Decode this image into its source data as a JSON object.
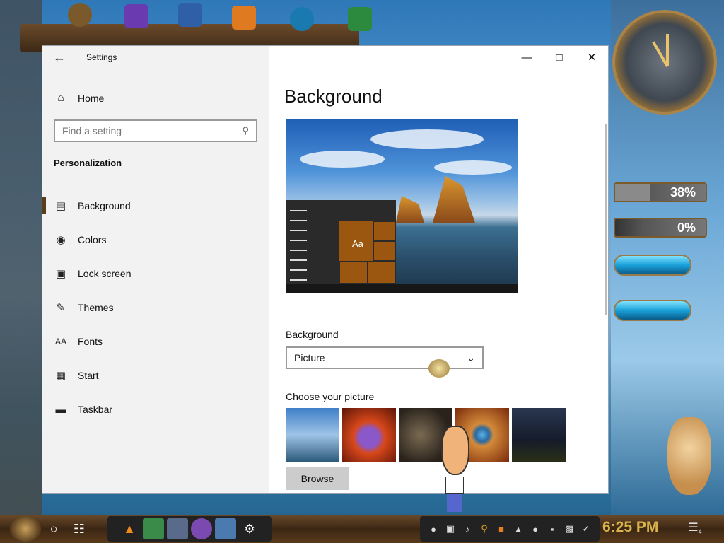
{
  "window": {
    "app_title": "Settings",
    "back_icon": "arrow-left-icon"
  },
  "sidebar": {
    "home_label": "Home",
    "search_placeholder": "Find a setting",
    "section_title": "Personalization",
    "items": [
      {
        "label": "Background",
        "icon": "picture-icon",
        "active": true
      },
      {
        "label": "Colors",
        "icon": "palette-icon",
        "active": false
      },
      {
        "label": "Lock screen",
        "icon": "lock-screen-icon",
        "active": false
      },
      {
        "label": "Themes",
        "icon": "brush-icon",
        "active": false
      },
      {
        "label": "Fonts",
        "icon": "font-icon",
        "active": false
      },
      {
        "label": "Start",
        "icon": "start-tiles-icon",
        "active": false
      },
      {
        "label": "Taskbar",
        "icon": "taskbar-icon",
        "active": false
      }
    ]
  },
  "content": {
    "title": "Background",
    "preview_tile_label": "Aa",
    "background_label": "Background",
    "background_value": "Picture",
    "choose_picture_label": "Choose your picture",
    "browse_label": "Browse",
    "thumbnails": [
      {
        "name": "beach-rock-thumbnail",
        "color": "#4f8fc8"
      },
      {
        "name": "purple-monster-fire-thumbnail",
        "color": "#c73a14"
      },
      {
        "name": "steampunk-figure-thumbnail",
        "color": "#3a3128"
      },
      {
        "name": "eye-closeup-thumbnail",
        "color": "#b25a1a"
      },
      {
        "name": "night-sky-thumbnail",
        "color": "#1a2232"
      }
    ]
  },
  "desktop": {
    "gauge_1": "38%",
    "gauge_2": "0%",
    "gauge_1_fraction": 0.38,
    "gauge_2_fraction": 0.0
  },
  "taskbar": {
    "time": "6:25 PM",
    "notification_count": "4",
    "accent_color": "#d8b24a"
  }
}
